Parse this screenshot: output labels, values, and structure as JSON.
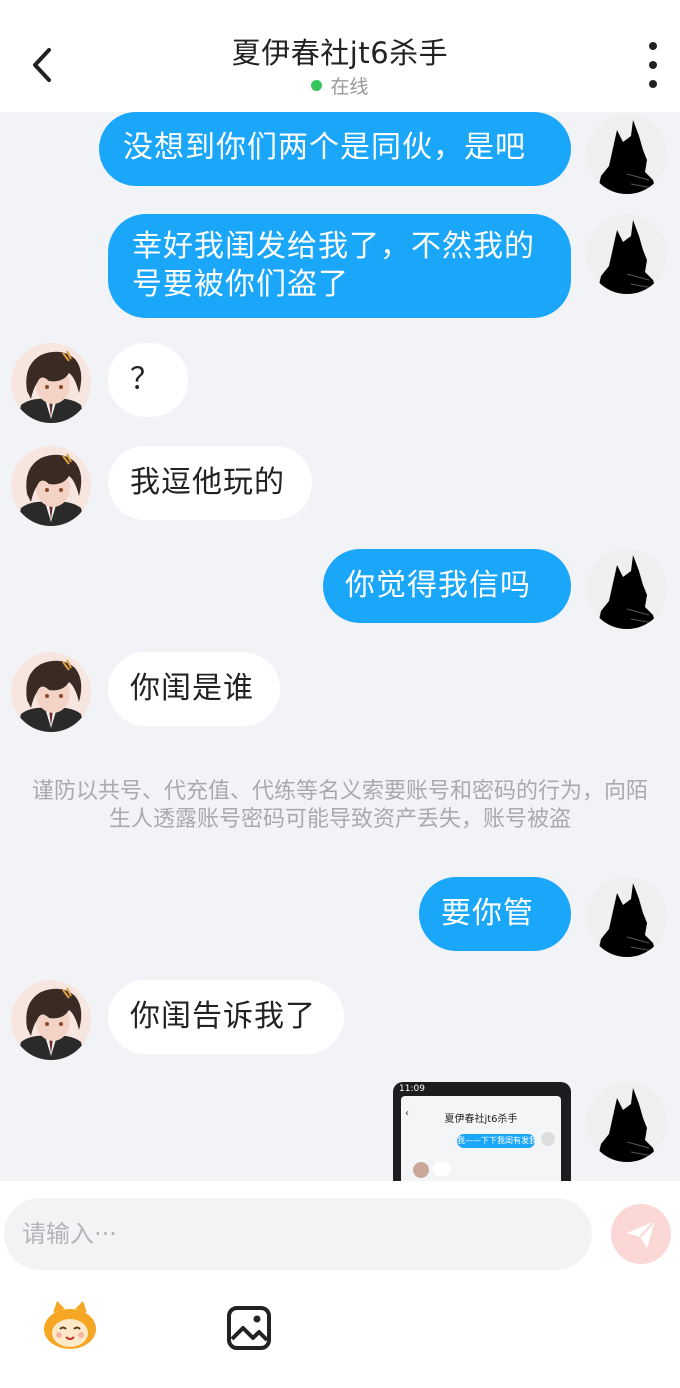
{
  "header": {
    "title": "夏伊春社jt6杀手",
    "status": "在线"
  },
  "messages": [
    {
      "from": "me",
      "text": "没想到你们两个是同伙，是吧"
    },
    {
      "from": "me",
      "text": "幸好我闺发给我了，不然我的号要被你们盗了"
    },
    {
      "from": "other",
      "text": "？"
    },
    {
      "from": "other",
      "text": "我逗他玩的"
    },
    {
      "from": "me",
      "text": "你觉得我信吗"
    },
    {
      "from": "other",
      "text": "你闺是谁"
    },
    {
      "from": "me",
      "text": "要你管"
    },
    {
      "from": "other",
      "text": "你闺告诉我了"
    }
  ],
  "notice": "谨防以共号、代充值、代练等名义索要账号和密码的行为，向陌生人透露账号密码可能导致资产丢失，账号被盗",
  "image_message": {
    "status_time": "11:09",
    "inner_title": "夏伊春社jt6杀手",
    "inner_bubble": "我——下下我闺有发我"
  },
  "input": {
    "placeholder": "请输入···"
  },
  "icons": {
    "back": "chevron-left-icon",
    "more": "more-vertical-icon",
    "send": "paper-plane-icon",
    "emoji": "mascot-emoji-icon",
    "image": "image-icon"
  },
  "colors": {
    "outgoing_bubble": "#1aa6f9",
    "incoming_bubble": "#ffffff",
    "online_dot": "#35c55c",
    "send_button": "#fbd8d6"
  }
}
